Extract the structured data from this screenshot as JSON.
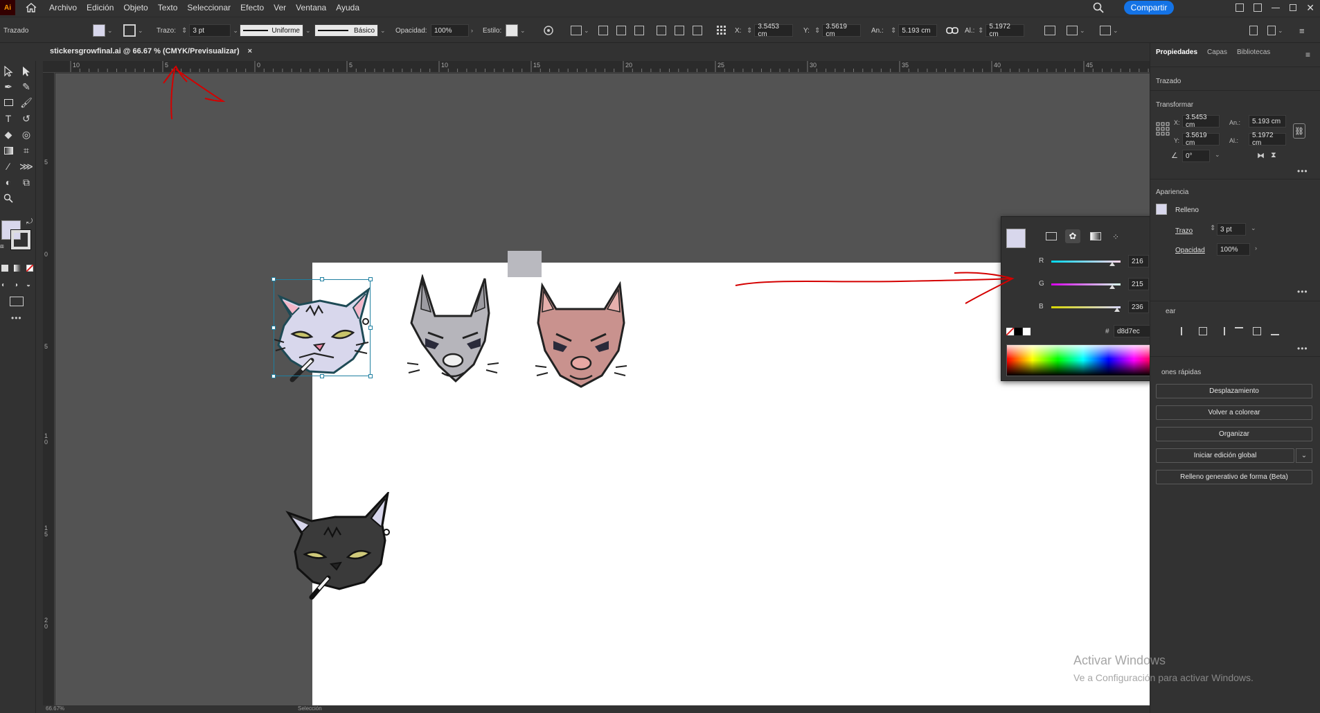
{
  "app": {
    "logo": "Ai",
    "share_label": "Compartir"
  },
  "menu": [
    "Archivo",
    "Edición",
    "Objeto",
    "Texto",
    "Seleccionar",
    "Efecto",
    "Ver",
    "Ventana",
    "Ayuda"
  ],
  "controlbar": {
    "mode_label": "Trazado",
    "stroke_label": "Trazo:",
    "stroke_value": "3 pt",
    "profile_label": "Uniforme",
    "brush_label": "Básico",
    "opacity_label": "Opacidad:",
    "opacity_value": "100%",
    "style_label": "Estilo:",
    "x_label": "X:",
    "x_value": "3.5453 cm",
    "y_label": "Y:",
    "y_value": "3.5619 cm",
    "w_label": "An.:",
    "w_value": "5.193 cm",
    "h_label": "Al.:",
    "h_value": "5.1972 cm"
  },
  "document": {
    "tab_title": "stickersgrowfinal.ai @ 66.67 % (CMYK/Previsualizar)",
    "close": "×"
  },
  "rulers": {
    "h": [
      "10",
      "5",
      "0",
      "5",
      "10",
      "15",
      "20",
      "25",
      "30",
      "35",
      "40",
      "45"
    ],
    "v": [
      "5",
      "0",
      "5",
      "10",
      "15",
      "20"
    ]
  },
  "color_picker": {
    "fill_hex_color": "#d8d7ec",
    "r_label": "R",
    "r_value": "216",
    "g_label": "G",
    "g_value": "215",
    "b_label": "B",
    "b_value": "236",
    "hash_label": "#",
    "hex_value": "d8d7ec"
  },
  "right_panel": {
    "tabs": [
      "Propiedades",
      "Capas",
      "Bibliotecas"
    ],
    "object_type": "Trazado",
    "transform_title": "Transformar",
    "x_label": "X:",
    "x_value": "3.5453 cm",
    "y_label": "Y:",
    "y_value": "3.5619 cm",
    "w_label": "An.:",
    "w_value": "5.193 cm",
    "h_label": "Al.:",
    "h_value": "5.1972 cm",
    "angle_value": "0°",
    "appearance_title": "Apariencia",
    "fill_label": "Relleno",
    "stroke_label": "Trazo",
    "stroke_value": "3 pt",
    "opacity_label": "Opacidad",
    "opacity_value": "100%",
    "align_title_partial": "ear",
    "quick_actions_title_partial": "ones rápidas",
    "buttons": [
      "Desplazamiento",
      "Volver a colorear",
      "Organizar",
      "Iniciar edición global",
      "Relleno generativo de forma (Beta)"
    ]
  },
  "watermark": {
    "title": "Activar Windows",
    "subtitle": "Ve a Configuración para activar Windows."
  },
  "status": {
    "zoom": "66.67%",
    "tool": "Selección"
  }
}
